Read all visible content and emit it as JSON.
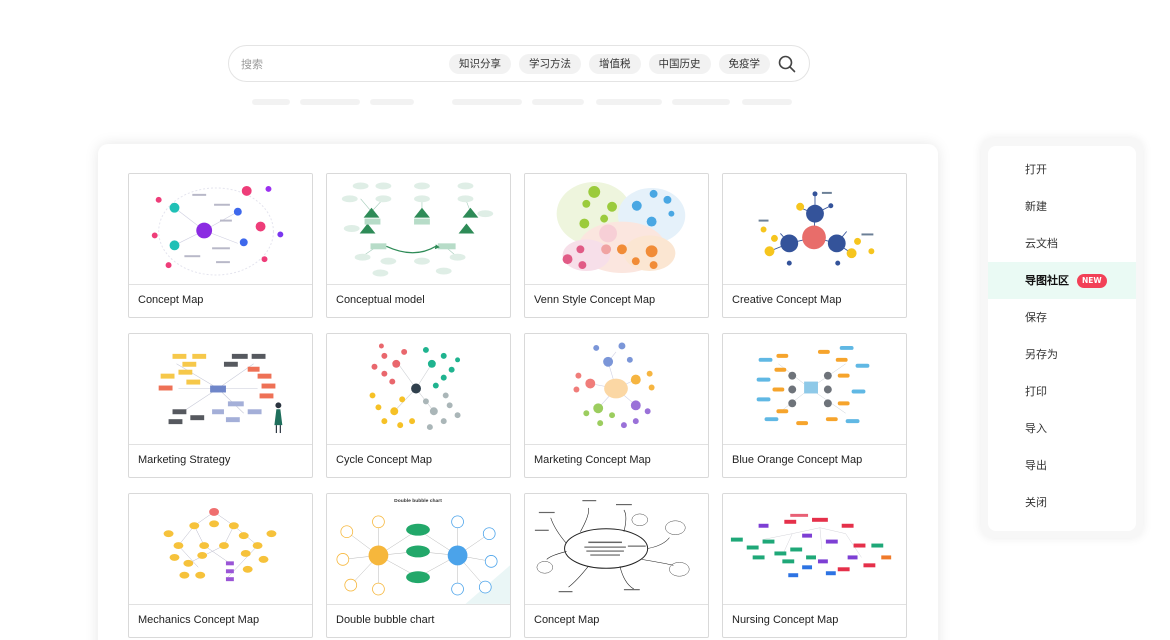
{
  "search": {
    "placeholder": "搜索",
    "chips": [
      "知识分享",
      "学习方法",
      "增值税",
      "中国历史",
      "免疫学"
    ],
    "icon": "search-icon"
  },
  "templates": [
    {
      "title": "Concept Map"
    },
    {
      "title": "Conceptual model"
    },
    {
      "title": "Venn Style Concept Map"
    },
    {
      "title": "Creative Concept Map"
    },
    {
      "title": "Marketing Strategy"
    },
    {
      "title": "Cycle Concept Map"
    },
    {
      "title": "Marketing Concept Map"
    },
    {
      "title": "Blue Orange Concept Map"
    },
    {
      "title": "Mechanics Concept Map"
    },
    {
      "title": "Double bubble chart",
      "thumb_heading": "Double bubble chart"
    },
    {
      "title": "Concept Map"
    },
    {
      "title": "Nursing Concept Map"
    }
  ],
  "menu": {
    "items": [
      "打开",
      "新建",
      "云文档",
      "导图社区",
      "保存",
      "另存为",
      "打印",
      "导入",
      "导出",
      "关闭"
    ],
    "active_index": 3,
    "new_badge": "NEW"
  },
  "colors": {
    "accent_active_bg": "#eafaf4",
    "badge": "#f24157"
  }
}
